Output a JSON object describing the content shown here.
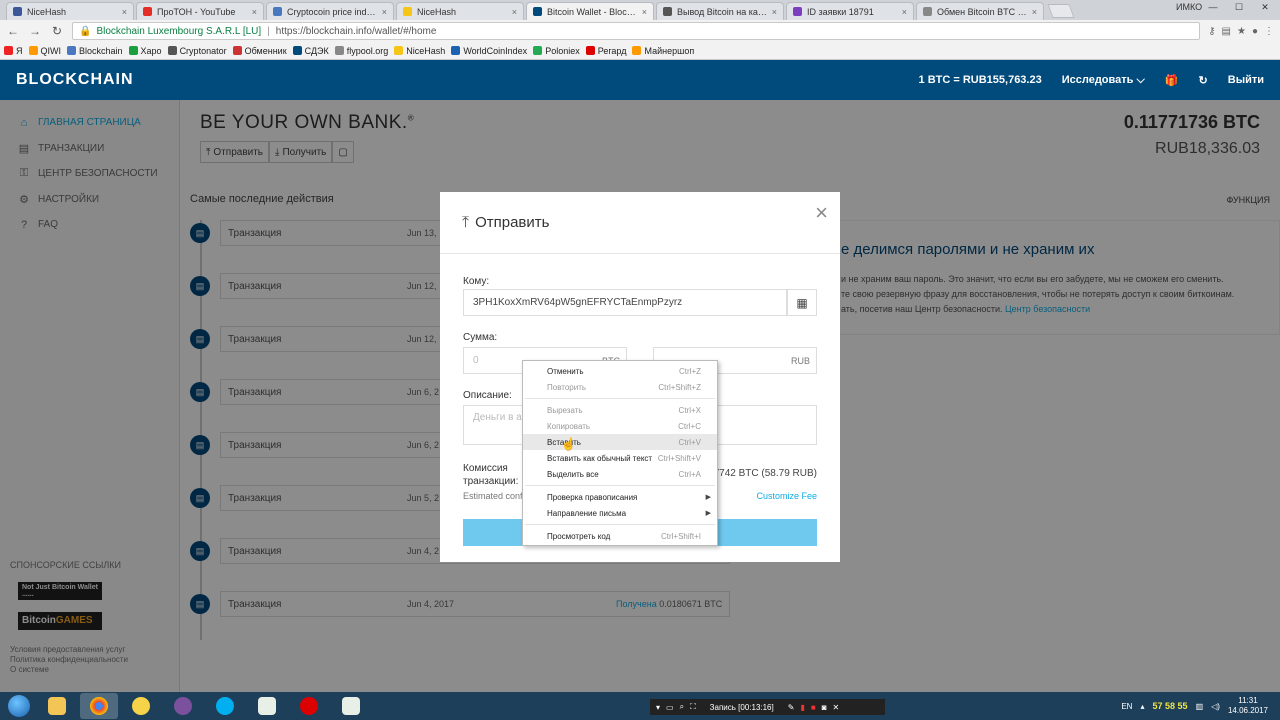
{
  "browser": {
    "tabs": [
      {
        "label": "NiceHash",
        "color": "#3b5998",
        "active": false
      },
      {
        "label": "ПроТОН - YouTube",
        "color": "#e52d27",
        "active": false
      },
      {
        "label": "Cryptocoin price index a",
        "color": "#4a78c0",
        "active": false
      },
      {
        "label": "NiceHash",
        "color": "#f5c518",
        "active": false
      },
      {
        "label": "Bitcoin Wallet - Blockcha",
        "color": "#004a7c",
        "active": true
      },
      {
        "label": "Вывод Bitcoin на карту",
        "color": "#555555",
        "active": false
      },
      {
        "label": "ID заявки 18791",
        "color": "#7c3fbf",
        "active": false
      },
      {
        "label": "Обмен Bitcoin BTC на Сб",
        "color": "#888888",
        "active": false
      }
    ],
    "window_user": "ИМКО",
    "address": {
      "secure_label": "Blockchain Luxembourg S.A.R.L [LU]",
      "url": "https://blockchain.info/wallet/#/home"
    },
    "bookmarks": [
      "Я",
      "QIWI",
      "Blockchain",
      "Хаpo",
      "Cryptonator",
      "Обменник",
      "СДЭК",
      "flypool.org",
      "NiceHash",
      "WorldCoinIndex",
      "Poloniex",
      "Регард",
      "Майнершоп"
    ]
  },
  "header": {
    "logo": "BLOCKCHAIN",
    "rate": "1 BTC = RUB155,763.23",
    "explore": "Исследовать",
    "logout": "Выйти"
  },
  "sidebar": {
    "items": [
      {
        "label": "ГЛАВНАЯ СТРАНИЦА",
        "icon": "home-icon",
        "active": true
      },
      {
        "label": "ТРАНЗАКЦИИ",
        "icon": "list-icon",
        "active": false
      },
      {
        "label": "ЦЕНТР БЕЗОПАСНОСТИ",
        "icon": "lock-icon",
        "active": false
      },
      {
        "label": "НАСТРОЙКИ",
        "icon": "gear-icon",
        "active": false
      },
      {
        "label": "FAQ",
        "icon": "help-icon",
        "active": false
      }
    ],
    "sponsored_title": "СПОНСОРСКИЕ ССЫЛКИ",
    "ad1": "Not Just Bitcoin Wallet ......",
    "ad2_a": "Bitcoin",
    "ad2_b": "GAMES",
    "links": [
      "Условия предоставления услуг",
      "Политика конфиденциальности",
      "О системе"
    ]
  },
  "main": {
    "title": "BE YOUR OWN BANK.",
    "send_button": "Отправить",
    "receive_button": "Получить",
    "balance_btc": "0.11771736 BTC",
    "balance_rub": "RUB18,336.03",
    "recent_title": "Самые последние действия",
    "function_label": "ФУНКЦИЯ",
    "transactions": [
      {
        "label": "Транзакция",
        "date": "Jun 13,"
      },
      {
        "label": "Транзакция",
        "date": "Jun 12,"
      },
      {
        "label": "Транзакция",
        "date": "Jun 12,"
      },
      {
        "label": "Транзакция",
        "date": "Jun 6, 2"
      },
      {
        "label": "Транзакция",
        "date": "Jun 6, 2"
      },
      {
        "label": "Транзакция",
        "date": "Jun 5, 2"
      },
      {
        "label": "Транзакция",
        "date": "Jun 4, 2"
      },
      {
        "label": "Транзакция",
        "date": "Jun 4, 2017",
        "status": "Получена",
        "amount": "0.0180671 BTC"
      }
    ],
    "info_title": "е делимся паролями и не храним их",
    "info_text_1": "и не храним ваш пароль. Это значит, что если вы его забудете, мы не сможем его сменить.",
    "info_text_2": "те свою резервную фразу для восстановления, чтобы не потерять доступ к своим биткоинам.",
    "info_text_3": "ать, посетив наш Центр безопасности.",
    "info_link": "Центр безопасности"
  },
  "modal": {
    "title": "Отправить",
    "to_label": "Кому:",
    "to_value": "3PH1KoxXmRV64pW5gnEFRYCTaEnmpPzyrz",
    "amount_label": "Сумма:",
    "amount_btc": "0",
    "btc_unit": "BTC",
    "rub_unit": "RUB",
    "desc_label": "Описание:",
    "desc_placeholder": "Деньги в ар",
    "fee_label_1": "Комиссия",
    "fee_label_2": "транзакции:",
    "fee_value": "7742 BTC (58.79 RUB)",
    "estimated": "Estimated conf",
    "custom_fee": "Customize Fee"
  },
  "context_menu": {
    "items": [
      {
        "label": "Отменить",
        "shortcut": "Ctrl+Z",
        "disabled": false
      },
      {
        "label": "Повторить",
        "shortcut": "Ctrl+Shift+Z",
        "disabled": true
      },
      {
        "sep": true
      },
      {
        "label": "Вырезать",
        "shortcut": "Ctrl+X",
        "disabled": true
      },
      {
        "label": "Копировать",
        "shortcut": "Ctrl+C",
        "disabled": true
      },
      {
        "label": "Вставить",
        "shortcut": "Ctrl+V",
        "disabled": false,
        "hover": true
      },
      {
        "label": "Вставить как обычный текст",
        "shortcut": "Ctrl+Shift+V",
        "disabled": false
      },
      {
        "label": "Выделить все",
        "shortcut": "Ctrl+A",
        "disabled": false
      },
      {
        "sep": true
      },
      {
        "label": "Проверка правописания",
        "submenu": true
      },
      {
        "label": "Направление письма",
        "submenu": true
      },
      {
        "sep": true
      },
      {
        "label": "Просмотреть код",
        "shortcut": "Ctrl+Shift+I",
        "disabled": false
      }
    ]
  },
  "taskbar": {
    "recording": "Запись [00:13:16]",
    "lang": "EN",
    "temps": [
      "57",
      "58",
      "55"
    ],
    "time": "11:31",
    "date": "14.06.2017"
  }
}
